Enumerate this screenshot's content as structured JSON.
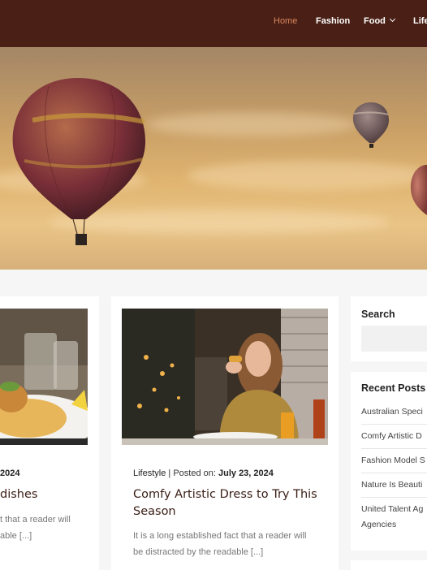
{
  "nav": {
    "items": [
      {
        "label": "Home"
      },
      {
        "label": "Fashion"
      },
      {
        "label": "Food"
      },
      {
        "label": "Life"
      }
    ]
  },
  "posts": [
    {
      "meta_date": "2024",
      "title": "dishes",
      "excerpt_line1": "t that a reader will",
      "excerpt_line2": "able [...]"
    },
    {
      "category": "Lifestyle",
      "meta_sep": "| Posted on:",
      "date": "July 23, 2024",
      "title_line1": "Comfy Artistic Dress to Try This",
      "title_line2": "Season",
      "excerpt_line1": "It is a long established fact that a reader will",
      "excerpt_line2": "be distracted by the readable [...]"
    }
  ],
  "sidebar": {
    "search_title": "Search",
    "recent_title": "Recent Posts",
    "recent_posts": [
      "Australian Speci",
      "Comfy Artistic D",
      "Fashion Model S",
      "Nature Is Beauti",
      "United Talent Ag",
      "Agencies"
    ]
  }
}
